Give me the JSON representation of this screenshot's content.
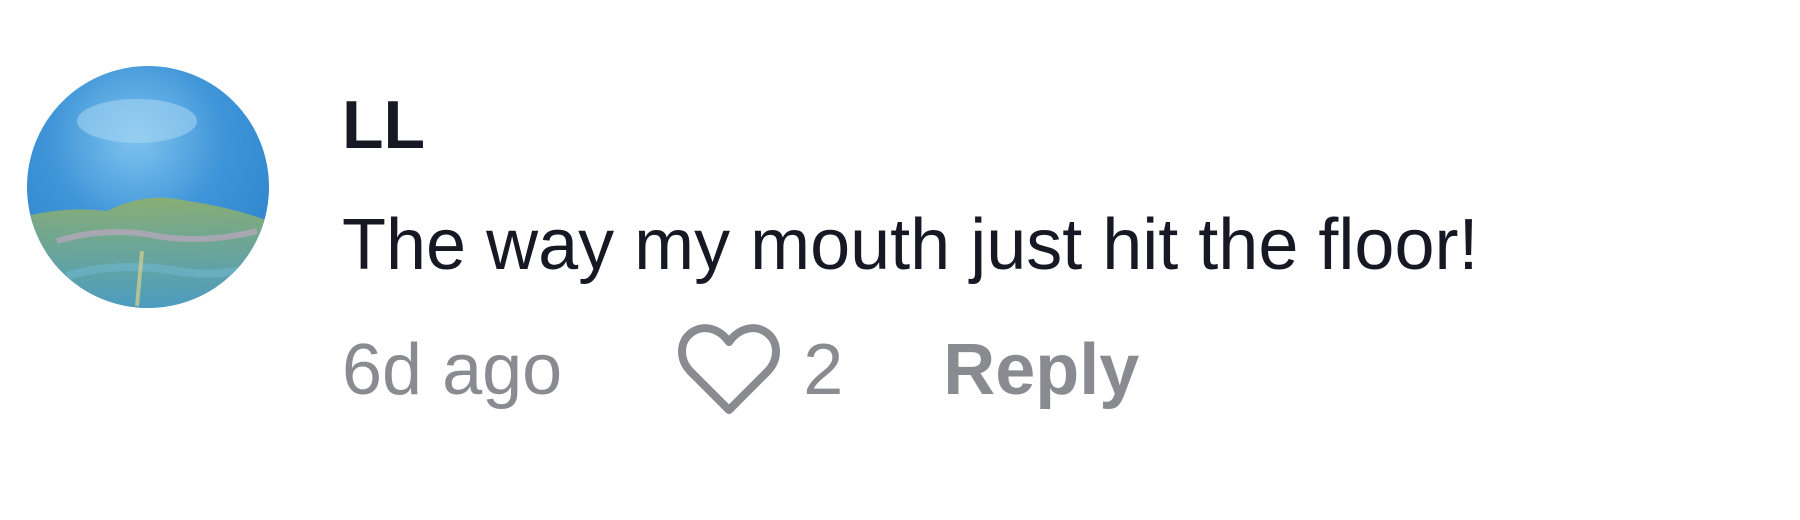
{
  "comment": {
    "username": "LL",
    "text": "The way my mouth just hit the floor!",
    "time": "6d ago",
    "like_icon": "heart-outline-icon",
    "like_count": "2",
    "reply_label": "Reply"
  },
  "colors": {
    "primary_text": "#161823",
    "secondary_text": "#8a8b91",
    "background": "#ffffff"
  }
}
